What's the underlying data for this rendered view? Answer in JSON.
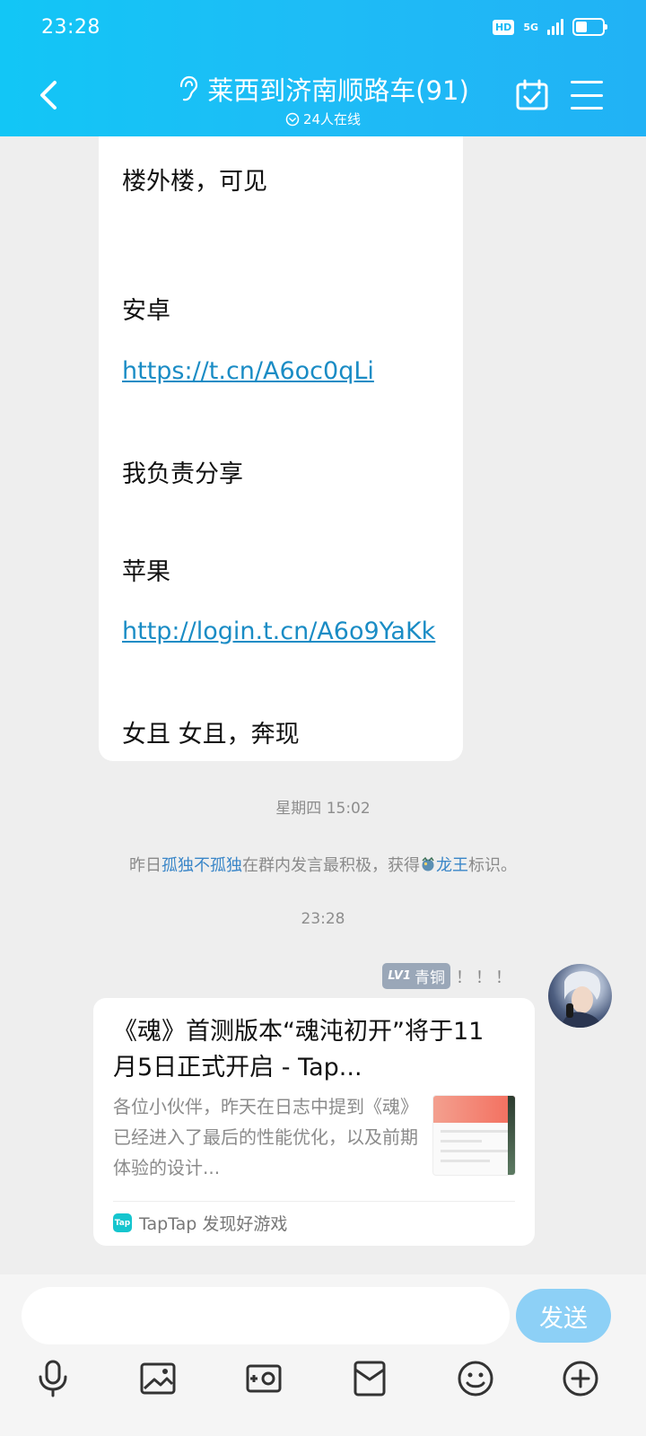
{
  "status_bar": {
    "time": "23:28",
    "hd": "HD",
    "network": "5G"
  },
  "header": {
    "title": "莱西到济南顺路车(91)",
    "online": "24人在线"
  },
  "message": {
    "lines": [
      {
        "text": "楼外楼，可见"
      },
      {
        "text": "安卓"
      },
      {
        "text": "https://t.cn/A6oc0qLi"
      },
      {
        "text": "我负责分享"
      },
      {
        "text": "苹果"
      },
      {
        "text": "http://login.t.cn/A6o9YaKk"
      },
      {
        "text": "女且 女且，奔现"
      }
    ]
  },
  "timestamps": {
    "first": "星期四 15:02",
    "second": "23:28"
  },
  "system_notice": {
    "prefix": "昨日",
    "user": "孤独不孤独",
    "middle": "在群内发言最积极，获得",
    "title": "龙王",
    "suffix": "标识。"
  },
  "sender": {
    "level": "LV1",
    "rank": "青铜",
    "name": "！！！"
  },
  "share_card": {
    "title": "《魂》首测版本“魂沌初开”将于11月5日正式开启 - Tap...",
    "description": "各位小伙伴，昨天在日志中提到《魂》已经进入了最后的性能优化，以及前期体验的设计...",
    "source": "TapTap 发现好游戏",
    "source_icon_text": "Tap"
  },
  "input": {
    "placeholder": "",
    "send_label": "发送"
  },
  "toolbar": [
    "mic-icon",
    "image-icon",
    "camera-icon",
    "red-packet-icon",
    "emoji-icon",
    "plus-icon"
  ],
  "colors": {
    "header": "#1ebcf6",
    "link": "#1a8cc5",
    "send_button": "#8dd0f6",
    "notice_highlight": "#3a86c8"
  }
}
